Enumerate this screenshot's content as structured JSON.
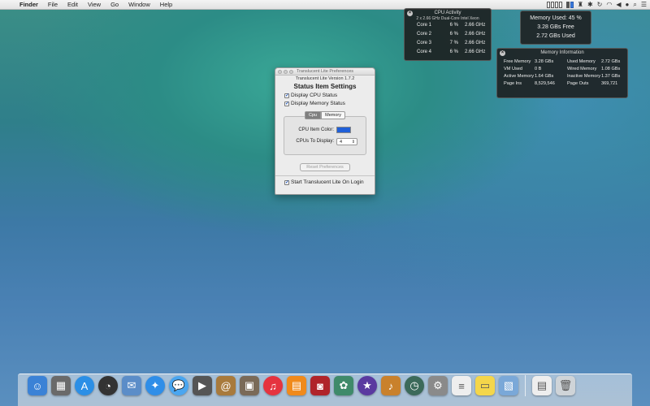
{
  "menubar": {
    "apple": "",
    "items": [
      "Finder",
      "File",
      "Edit",
      "View",
      "Go",
      "Window",
      "Help"
    ]
  },
  "cpu_panel": {
    "title": "CPU Activity",
    "subtitle": "2 x 2.66 GHz Dual-Core Intel Xeon",
    "cores": [
      {
        "name": "Core 1",
        "usage": "6 %",
        "speed": "2.66 GHz"
      },
      {
        "name": "Core 2",
        "usage": "6 %",
        "speed": "2.66 GHz"
      },
      {
        "name": "Core 3",
        "usage": "7 %",
        "speed": "2.66 GHz"
      },
      {
        "name": "Core 4",
        "usage": "6 %",
        "speed": "2.66 GHz"
      }
    ]
  },
  "memory_summary": {
    "used": "Memory Used: 45 %",
    "free": "3.28 GBs Free",
    "used_amount": "2.72 GBs Used"
  },
  "memory_info": {
    "title": "Memory Information",
    "rows": [
      {
        "l1": "Free Memory",
        "v1": "3.28 GBs",
        "l2": "Used Memory",
        "v2": "2.72 GBs"
      },
      {
        "l1": "VM Used",
        "v1": "0 B",
        "l2": "Wired Memory",
        "v2": "1.08 GBs"
      },
      {
        "l1": "Active Memory",
        "v1": "1.64 GBs",
        "l2": "Inactive Memory",
        "v2": "1.37 GBs"
      },
      {
        "l1": "Page Ins",
        "v1": "8,529,546",
        "l2": "Page Outs",
        "v2": "369,721"
      }
    ]
  },
  "prefs_window": {
    "title": "Translucent Lite Preferences",
    "version": "Translucent Lite Version 1.7.2",
    "heading": "Status Item Settings",
    "display_cpu": "Display CPU Status",
    "display_memory": "Display Memory Status",
    "tab_cpu": "Cpu",
    "tab_memory": "Memory",
    "cpu_color_label": "CPU Item Color:",
    "cpus_display_label": "CPUs To Display:",
    "cpus_display_value": "4",
    "reset_button": "Reset Preferences",
    "login_label": "Start Translucent Lite On Login",
    "cpu_color": "#1f5fd8"
  },
  "dock": {
    "apps": [
      {
        "icon": "finder-icon",
        "color": "#3b82d6",
        "glyph": "☺"
      },
      {
        "icon": "launchpad-icon",
        "color": "#6a6a6a",
        "glyph": "▦"
      },
      {
        "icon": "app-store-icon",
        "color": "#2b8fe6",
        "glyph": "A"
      },
      {
        "icon": "dashboard-icon",
        "color": "#333",
        "glyph": "◔"
      },
      {
        "icon": "preview-icon",
        "color": "#5b8dc8",
        "glyph": "✉"
      },
      {
        "icon": "safari-icon",
        "color": "#2f8ee8",
        "glyph": "✦"
      },
      {
        "icon": "messages-icon",
        "color": "#4aa6f0",
        "glyph": "💬"
      },
      {
        "icon": "facetime-icon",
        "color": "#555",
        "glyph": "▶"
      },
      {
        "icon": "contacts-icon",
        "color": "#a87a3c",
        "glyph": "@"
      },
      {
        "icon": "photo-browser-icon",
        "color": "#7a6a58",
        "glyph": "▣"
      },
      {
        "icon": "itunes-icon",
        "color": "#e5333f",
        "glyph": "♫"
      },
      {
        "icon": "ibooks-icon",
        "color": "#f08a1c",
        "glyph": "▤"
      },
      {
        "icon": "photo-booth-icon",
        "color": "#b0242a",
        "glyph": "◙"
      },
      {
        "icon": "iphoto-icon",
        "color": "#3f8a6a",
        "glyph": "✿"
      },
      {
        "icon": "imovie-icon",
        "color": "#5a3aa0",
        "glyph": "★"
      },
      {
        "icon": "garageband-icon",
        "color": "#c9812c",
        "glyph": "♪"
      },
      {
        "icon": "time-machine-icon",
        "color": "#3c6a5a",
        "glyph": "◷"
      },
      {
        "icon": "system-preferences-icon",
        "color": "#8a8a8a",
        "glyph": "⚙"
      },
      {
        "icon": "textedit-icon",
        "color": "#eeeeee",
        "glyph": "≡"
      },
      {
        "icon": "stickies-icon",
        "color": "#f4d64a",
        "glyph": "▭"
      },
      {
        "icon": "preview-docs-icon",
        "color": "#7aa8d8",
        "glyph": "▧"
      }
    ],
    "right": [
      {
        "icon": "documents-stack-icon",
        "color": "#eeeeee",
        "glyph": "▤"
      },
      {
        "icon": "trash-icon",
        "color": "#cfd4d8",
        "glyph": "🗑"
      }
    ]
  }
}
